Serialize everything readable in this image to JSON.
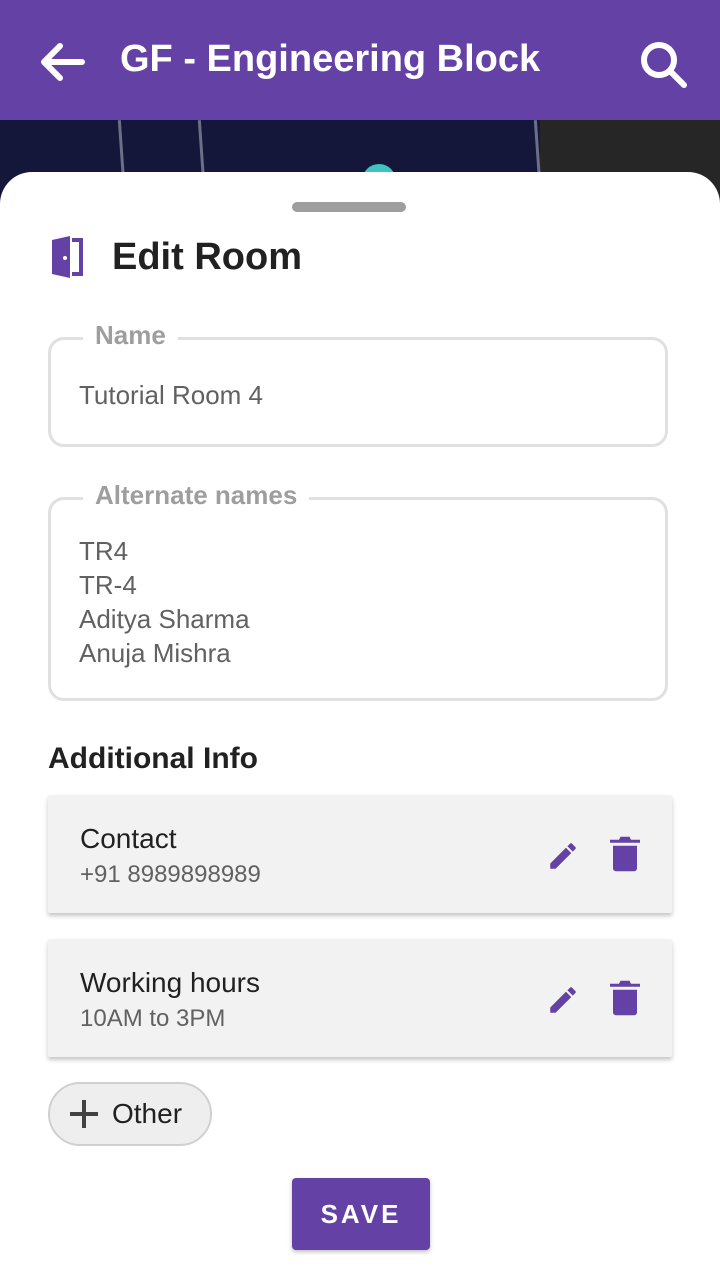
{
  "appbar": {
    "title": "GF - Engineering Block"
  },
  "sheet": {
    "title": "Edit Room",
    "name_field": {
      "label": "Name",
      "value": "Tutorial Room 4"
    },
    "alternate_names_field": {
      "label": "Alternate names",
      "values": [
        "TR4",
        "TR-4",
        "Aditya Sharma",
        "Anuja Mishra"
      ]
    },
    "additional_info": {
      "heading": "Additional Info",
      "items": [
        {
          "title": "Contact",
          "value": "+91 8989898989"
        },
        {
          "title": "Working hours",
          "value": "10AM to 3PM"
        }
      ]
    },
    "add_chip": {
      "label": "Other"
    },
    "save_label": "SAVE"
  },
  "colors": {
    "primary": "#6441a5",
    "card_bg": "#f2f2f2",
    "label_grey": "#9e9e9e"
  },
  "icons": [
    "arrow-back-icon",
    "search-icon",
    "door-icon",
    "edit-icon",
    "delete-icon",
    "plus-icon"
  ]
}
